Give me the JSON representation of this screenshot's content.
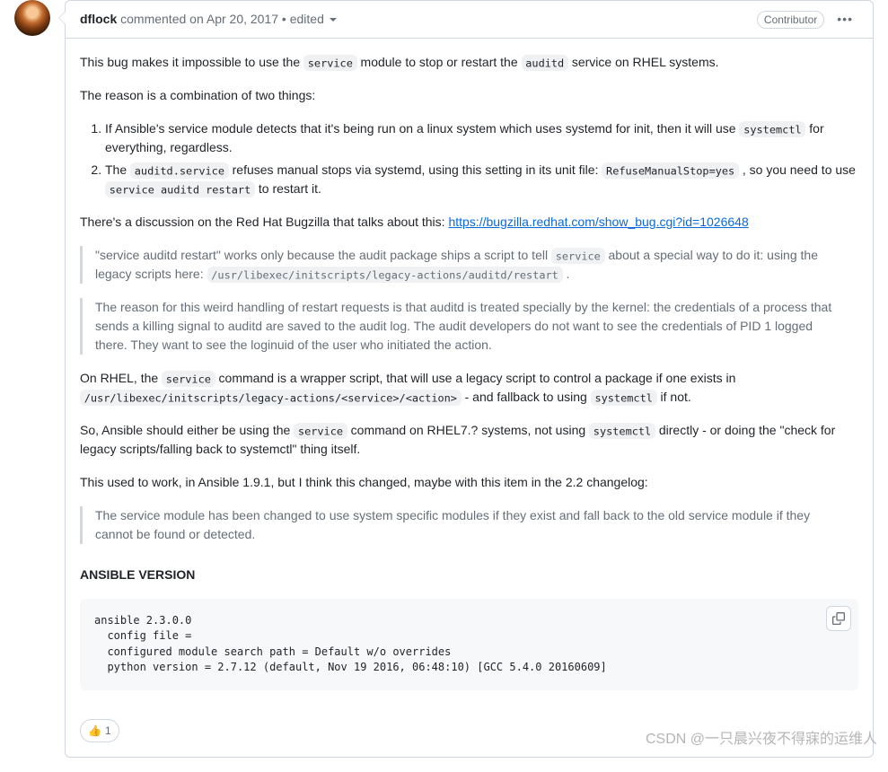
{
  "header": {
    "author": "dflock",
    "commented": " commented ",
    "date": "on Apr 20, 2017",
    "edited_sep": " • ",
    "edited": "edited ",
    "badge": "Contributor"
  },
  "body": {
    "p1_a": "This bug makes it impossible to use the ",
    "p1_code1": "service",
    "p1_b": " module to stop or restart the ",
    "p1_code2": "auditd",
    "p1_c": " service on RHEL systems.",
    "p2": "The reason is a combination of two things:",
    "li1_a": "If Ansible's service module detects that it's being run on a linux system which uses systemd for init, then it will use ",
    "li1_code": "systemctl",
    "li1_b": " for everything, regardless.",
    "li2_a": "The ",
    "li2_code1": "auditd.service",
    "li2_b": " refuses manual stops via systemd, using this setting in its unit file: ",
    "li2_code2": "RefuseManualStop=yes",
    "li2_c": " , so you need to use ",
    "li2_code3": "service auditd restart",
    "li2_d": " to restart it.",
    "p3_a": "There's a discussion on the Red Hat Bugzilla that talks about this: ",
    "p3_link": "https://bugzilla.redhat.com/show_bug.cgi?id=1026648",
    "bq1_a": "\"service auditd restart\" works only because the audit package ships a script to tell ",
    "bq1_code1": "service",
    "bq1_b": " about a special way to do it: using the legacy scripts here: ",
    "bq1_code2": "/usr/libexec/initscripts/legacy-actions/auditd/restart",
    "bq1_c": " .",
    "bq2": "The reason for this weird handling of restart requests is that auditd is treated specially by the kernel: the credentials of a process that sends a killing signal to auditd are saved to the audit log. The audit developers do not want to see the credentials of PID 1 logged there. They want to see the loginuid of the user who initiated the action.",
    "p4_a": "On RHEL, the ",
    "p4_code1": "service",
    "p4_b": " command is a wrapper script, that will use a legacy script to control a package if one exists in ",
    "p4_code2": "/usr/libexec/initscripts/legacy-actions/<service>/<action>",
    "p4_c": " - and fallback to using ",
    "p4_code3": "systemctl",
    "p4_d": " if not.",
    "p5_a": "So, Ansible should either be using the ",
    "p5_code1": "service",
    "p5_b": " command on RHEL7.? systems, not using ",
    "p5_code2": "systemctl",
    "p5_c": " directly - or doing the \"check for legacy scripts/falling back to systemctl\" thing itself.",
    "p6": "This used to work, in Ansible 1.9.1, but I think this changed, maybe with this item in the 2.2 changelog:",
    "bq3": "The service module has been changed to use system specific modules if they exist and fall back to the old service module if they cannot be found or detected.",
    "h_version": "ANSIBLE VERSION",
    "codeblock": "ansible 2.3.0.0\n  config file =\n  configured module search path = Default w/o overrides\n  python version = 2.7.12 (default, Nov 19 2016, 06:48:10) [GCC 5.4.0 20160609]"
  },
  "reactions": {
    "thumbsup_emoji": "👍",
    "thumbsup_count": "1"
  },
  "watermark": "CSDN @一只晨兴夜不得寐的运维人"
}
